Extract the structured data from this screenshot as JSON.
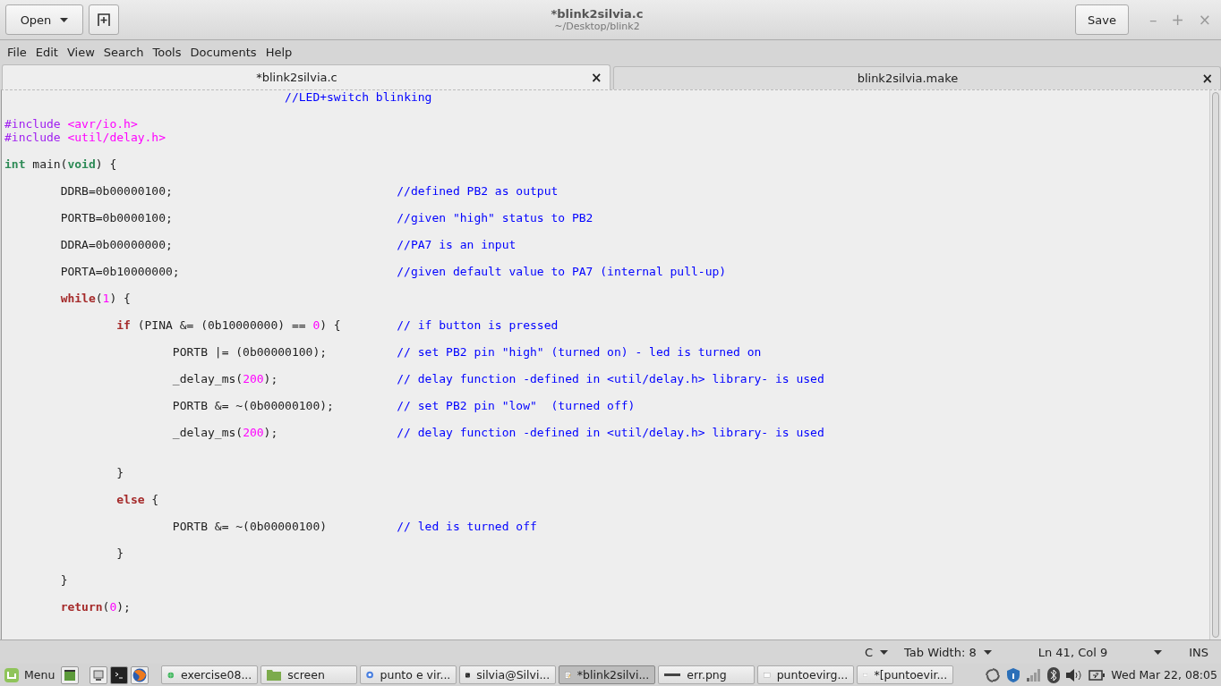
{
  "header": {
    "open_button": "Open",
    "title": "*blink2silvia.c",
    "subtitle": "~/Desktop/blink2",
    "save_button": "Save",
    "window_controls": [
      "–",
      "+",
      "×"
    ]
  },
  "menu": [
    "File",
    "Edit",
    "View",
    "Search",
    "Tools",
    "Documents",
    "Help"
  ],
  "tabs": [
    {
      "label": "*blink2silvia.c",
      "close": "×",
      "selected": true
    },
    {
      "label": "blink2silvia.make",
      "close": "×",
      "selected": false
    }
  ],
  "code": {
    "lines": [
      {
        "kind": "code",
        "segments": [
          {
            "kind": "comment",
            "text": "\t\t\t\t\t//LED+switch blinking"
          }
        ]
      },
      {
        "kind": "blank"
      },
      {
        "kind": "code",
        "segments": [
          {
            "kind": "preproc",
            "text": "#include "
          },
          {
            "kind": "string",
            "text": "<avr/io.h>"
          }
        ]
      },
      {
        "kind": "code",
        "segments": [
          {
            "kind": "preproc",
            "text": "#include "
          },
          {
            "kind": "string",
            "text": "<util/delay.h>"
          }
        ]
      },
      {
        "kind": "blank"
      },
      {
        "kind": "code",
        "segments": [
          {
            "kind": "type",
            "text": "int"
          },
          {
            "kind": "plain",
            "text": " main("
          },
          {
            "kind": "type",
            "text": "void"
          },
          {
            "kind": "plain",
            "text": ") {"
          }
        ]
      },
      {
        "kind": "blank"
      },
      {
        "kind": "code",
        "segments": [
          {
            "kind": "plain",
            "text": "\tDDRB=0b00000100;\t\t\t\t"
          },
          {
            "kind": "comment",
            "text": "//defined PB2 as output"
          }
        ]
      },
      {
        "kind": "blank"
      },
      {
        "kind": "code",
        "segments": [
          {
            "kind": "plain",
            "text": "\tPORTB=0b0000100;\t\t\t\t"
          },
          {
            "kind": "comment",
            "text": "//given \"high\" status to PB2"
          }
        ]
      },
      {
        "kind": "blank"
      },
      {
        "kind": "code",
        "segments": [
          {
            "kind": "plain",
            "text": "\tDDRA=0b00000000;\t\t\t\t"
          },
          {
            "kind": "comment",
            "text": "//PA7 is an input"
          }
        ]
      },
      {
        "kind": "blank"
      },
      {
        "kind": "code",
        "segments": [
          {
            "kind": "plain",
            "text": "\tPORTA=0b10000000;\t\t\t\t"
          },
          {
            "kind": "comment",
            "text": "//given default value to PA7 (internal pull-up)"
          }
        ]
      },
      {
        "kind": "blank"
      },
      {
        "kind": "code",
        "segments": [
          {
            "kind": "keyword",
            "text": "\twhile"
          },
          {
            "kind": "plain",
            "text": "("
          },
          {
            "kind": "number",
            "text": "1"
          },
          {
            "kind": "plain",
            "text": ") {"
          }
        ]
      },
      {
        "kind": "blank"
      },
      {
        "kind": "code",
        "segments": [
          {
            "kind": "keyword",
            "text": "\t\tif"
          },
          {
            "kind": "plain",
            "text": " (PINA &= (0b10000000) == "
          },
          {
            "kind": "number",
            "text": "0"
          },
          {
            "kind": "plain",
            "text": ") {\t"
          },
          {
            "kind": "comment",
            "text": "// if button is pressed"
          }
        ]
      },
      {
        "kind": "blank"
      },
      {
        "kind": "code",
        "segments": [
          {
            "kind": "plain",
            "text": "\t\t\tPORTB |= (0b00000100);\t\t"
          },
          {
            "kind": "comment",
            "text": "// set PB2 pin \"high\" (turned on) - led is turned on"
          }
        ]
      },
      {
        "kind": "blank"
      },
      {
        "kind": "code",
        "segments": [
          {
            "kind": "plain",
            "text": "\t\t\t_delay_ms("
          },
          {
            "kind": "number",
            "text": "200"
          },
          {
            "kind": "plain",
            "text": ");\t\t\t"
          },
          {
            "kind": "comment",
            "text": "// delay function -defined in <util/delay.h> library- is used"
          }
        ]
      },
      {
        "kind": "blank"
      },
      {
        "kind": "code",
        "segments": [
          {
            "kind": "plain",
            "text": "\t\t\tPORTB &= ~(0b00000100);\t\t"
          },
          {
            "kind": "comment",
            "text": "// set PB2 pin \"low\"  (turned off)"
          }
        ]
      },
      {
        "kind": "blank"
      },
      {
        "kind": "code",
        "segments": [
          {
            "kind": "plain",
            "text": "\t\t\t_delay_ms("
          },
          {
            "kind": "number",
            "text": "200"
          },
          {
            "kind": "plain",
            "text": ");\t\t\t"
          },
          {
            "kind": "comment",
            "text": "// delay function -defined in <util/delay.h> library- is used"
          }
        ]
      },
      {
        "kind": "blank"
      },
      {
        "kind": "blank"
      },
      {
        "kind": "code",
        "segments": [
          {
            "kind": "plain",
            "text": "\t\t}"
          }
        ]
      },
      {
        "kind": "blank"
      },
      {
        "kind": "code",
        "segments": [
          {
            "kind": "keyword",
            "text": "\t\telse"
          },
          {
            "kind": "plain",
            "text": " {"
          }
        ]
      },
      {
        "kind": "blank"
      },
      {
        "kind": "code",
        "segments": [
          {
            "kind": "plain",
            "text": "\t\t\tPORTB &= ~(0b00000100)\t\t"
          },
          {
            "kind": "comment",
            "text": "// led is turned off"
          }
        ]
      },
      {
        "kind": "blank"
      },
      {
        "kind": "code",
        "segments": [
          {
            "kind": "plain",
            "text": "\t\t}"
          }
        ]
      },
      {
        "kind": "blank"
      },
      {
        "kind": "code",
        "segments": [
          {
            "kind": "plain",
            "text": "\t}"
          }
        ]
      },
      {
        "kind": "blank"
      },
      {
        "kind": "code",
        "segments": [
          {
            "kind": "keyword",
            "text": "\treturn"
          },
          {
            "kind": "plain",
            "text": "("
          },
          {
            "kind": "number",
            "text": "0"
          },
          {
            "kind": "plain",
            "text": ");"
          }
        ]
      }
    ]
  },
  "status_bar": {
    "language": "C",
    "tab_width": "Tab Width: 8",
    "position": "Ln 41, Col 9",
    "mode": "INS"
  },
  "taskbar": {
    "menu": "Menu",
    "windows": [
      {
        "kind": "globe",
        "label": "exercise08...",
        "selected": false
      },
      {
        "kind": "folder",
        "label": "screen",
        "selected": false
      },
      {
        "kind": "browser",
        "label": "punto e vir...",
        "selected": false
      },
      {
        "kind": "terminal",
        "label": "silvia@Silvi...",
        "selected": false
      },
      {
        "kind": "notepad",
        "label": "*blink2silvi...",
        "selected": true
      },
      {
        "kind": "image",
        "label": "err.png",
        "selected": false
      },
      {
        "kind": "window",
        "label": "puntoevirg...",
        "selected": false
      },
      {
        "kind": "window",
        "label": "*[puntoevir...",
        "selected": false
      }
    ],
    "clock": "Wed Mar 22, 08:05"
  }
}
